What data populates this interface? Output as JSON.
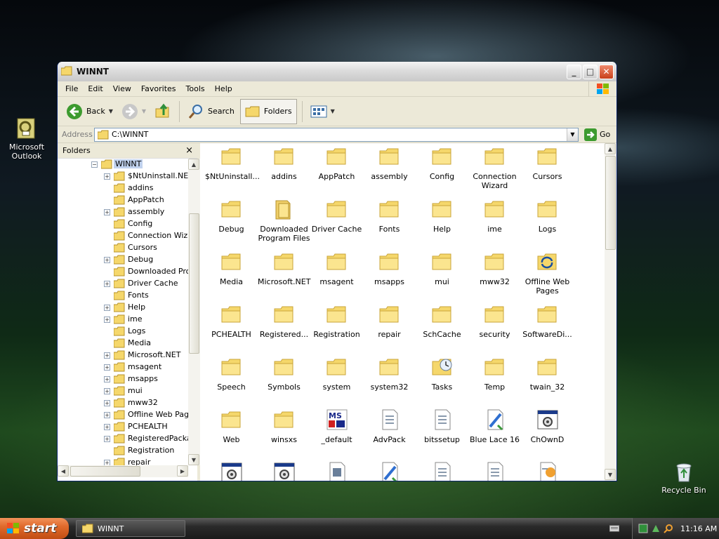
{
  "desktop": {
    "icons": [
      {
        "label": "Microsoft Outlook"
      },
      {
        "label": "Recycle Bin"
      }
    ]
  },
  "window": {
    "title": "WINNT",
    "menu": [
      "File",
      "Edit",
      "View",
      "Favorites",
      "Tools",
      "Help"
    ],
    "toolbar": {
      "back_label": "Back",
      "search_label": "Search",
      "folders_label": "Folders"
    },
    "address": {
      "label": "Address",
      "value": "C:\\WINNT",
      "go_label": "Go"
    },
    "folders_pane": {
      "title": "Folders",
      "close": "×",
      "tree": [
        {
          "label": "WINNT",
          "expander": "−",
          "selected": true
        },
        {
          "label": "$NtUninstall.NETF",
          "expander": "+"
        },
        {
          "label": "addins",
          "expander": ""
        },
        {
          "label": "AppPatch",
          "expander": ""
        },
        {
          "label": "assembly",
          "expander": "+"
        },
        {
          "label": "Config",
          "expander": ""
        },
        {
          "label": "Connection Wizar",
          "expander": ""
        },
        {
          "label": "Cursors",
          "expander": ""
        },
        {
          "label": "Debug",
          "expander": "+"
        },
        {
          "label": "Downloaded Prog",
          "expander": ""
        },
        {
          "label": "Driver Cache",
          "expander": "+"
        },
        {
          "label": "Fonts",
          "expander": ""
        },
        {
          "label": "Help",
          "expander": "+"
        },
        {
          "label": "ime",
          "expander": "+"
        },
        {
          "label": "Logs",
          "expander": ""
        },
        {
          "label": "Media",
          "expander": ""
        },
        {
          "label": "Microsoft.NET",
          "expander": "+"
        },
        {
          "label": "msagent",
          "expander": "+"
        },
        {
          "label": "msapps",
          "expander": "+"
        },
        {
          "label": "mui",
          "expander": "+"
        },
        {
          "label": "mww32",
          "expander": "+"
        },
        {
          "label": "Offline Web Page",
          "expander": "+"
        },
        {
          "label": "PCHEALTH",
          "expander": "+"
        },
        {
          "label": "RegisteredPackag",
          "expander": "+"
        },
        {
          "label": "Registration",
          "expander": ""
        },
        {
          "label": "repair",
          "expander": "+"
        }
      ]
    },
    "files": [
      {
        "label": "$NtUninstall...",
        "icon": "folder"
      },
      {
        "label": "addins",
        "icon": "folder"
      },
      {
        "label": "AppPatch",
        "icon": "folder"
      },
      {
        "label": "assembly",
        "icon": "folder"
      },
      {
        "label": "Config",
        "icon": "folder"
      },
      {
        "label": "Connection Wizard",
        "icon": "folder"
      },
      {
        "label": "Cursors",
        "icon": "folder"
      },
      {
        "label": "Debug",
        "icon": "folder"
      },
      {
        "label": "Downloaded Program Files",
        "icon": "folder-special"
      },
      {
        "label": "Driver Cache",
        "icon": "folder"
      },
      {
        "label": "Fonts",
        "icon": "folder"
      },
      {
        "label": "Help",
        "icon": "folder"
      },
      {
        "label": "ime",
        "icon": "folder"
      },
      {
        "label": "Logs",
        "icon": "folder"
      },
      {
        "label": "Media",
        "icon": "folder"
      },
      {
        "label": "Microsoft.NET",
        "icon": "folder"
      },
      {
        "label": "msagent",
        "icon": "folder"
      },
      {
        "label": "msapps",
        "icon": "folder"
      },
      {
        "label": "mui",
        "icon": "folder"
      },
      {
        "label": "mww32",
        "icon": "folder"
      },
      {
        "label": "Offline Web Pages",
        "icon": "folder-sync"
      },
      {
        "label": "PCHEALTH",
        "icon": "folder"
      },
      {
        "label": "Registered...",
        "icon": "folder"
      },
      {
        "label": "Registration",
        "icon": "folder"
      },
      {
        "label": "repair",
        "icon": "folder"
      },
      {
        "label": "SchCache",
        "icon": "folder"
      },
      {
        "label": "security",
        "icon": "folder"
      },
      {
        "label": "SoftwareDi...",
        "icon": "folder"
      },
      {
        "label": "Speech",
        "icon": "folder"
      },
      {
        "label": "Symbols",
        "icon": "folder"
      },
      {
        "label": "system",
        "icon": "folder"
      },
      {
        "label": "system32",
        "icon": "folder"
      },
      {
        "label": "Tasks",
        "icon": "folder-tasks"
      },
      {
        "label": "Temp",
        "icon": "folder"
      },
      {
        "label": "twain_32",
        "icon": "folder"
      },
      {
        "label": "Web",
        "icon": "folder"
      },
      {
        "label": "winsxs",
        "icon": "folder"
      },
      {
        "label": "_default",
        "icon": "ms-logo"
      },
      {
        "label": "AdvPack",
        "icon": "dll"
      },
      {
        "label": "bitssetup",
        "icon": "dll"
      },
      {
        "label": "Blue Lace 16",
        "icon": "bmp"
      },
      {
        "label": "ChOwnD",
        "icon": "exe"
      },
      {
        "label": "",
        "icon": "exe"
      },
      {
        "label": "",
        "icon": "exe"
      },
      {
        "label": "",
        "icon": "avi"
      },
      {
        "label": "",
        "icon": "bmp"
      },
      {
        "label": "",
        "icon": "dll"
      },
      {
        "label": "",
        "icon": "dll"
      },
      {
        "label": "",
        "icon": "setup"
      }
    ]
  },
  "taskbar": {
    "start_label": "start",
    "task_label": "WINNT",
    "clock": "11:16 AM"
  },
  "colors": {
    "folder_yellow": "#f5d76b",
    "start_orange": "#e06a2c",
    "selection_blue": "#c1d2ee"
  }
}
